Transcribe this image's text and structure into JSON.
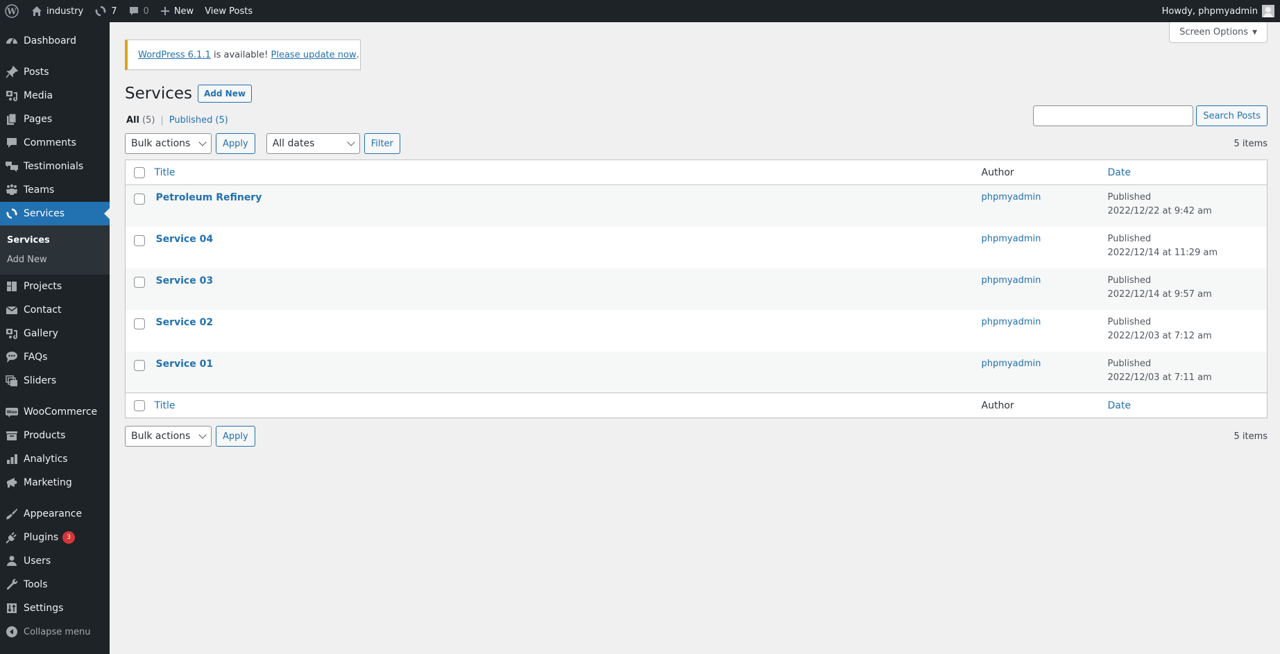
{
  "adminbar": {
    "site_name": "industry",
    "updates_count": "7",
    "comments_count": "0",
    "new_label": "New",
    "view_posts_label": "View Posts",
    "howdy": "Howdy, phpmyadmin"
  },
  "sidebar": {
    "items": [
      {
        "label": "Dashboard",
        "icon": "dashboard-icon"
      },
      {
        "label": "Posts",
        "icon": "pin-icon"
      },
      {
        "label": "Media",
        "icon": "media-icon"
      },
      {
        "label": "Pages",
        "icon": "pages-icon"
      },
      {
        "label": "Comments",
        "icon": "comment-icon"
      },
      {
        "label": "Testimonials",
        "icon": "testimonial-icon"
      },
      {
        "label": "Teams",
        "icon": "groups-icon"
      },
      {
        "label": "Services",
        "icon": "update-icon"
      },
      {
        "label": "Projects",
        "icon": "portfolio-icon"
      },
      {
        "label": "Contact",
        "icon": "email-icon"
      },
      {
        "label": "Gallery",
        "icon": "media-icon"
      },
      {
        "label": "FAQs",
        "icon": "chat-icon"
      },
      {
        "label": "Sliders",
        "icon": "slides-icon"
      },
      {
        "label": "WooCommerce",
        "icon": "woo-icon"
      },
      {
        "label": "Products",
        "icon": "archive-icon"
      },
      {
        "label": "Analytics",
        "icon": "chart-bar-icon"
      },
      {
        "label": "Marketing",
        "icon": "megaphone-icon"
      },
      {
        "label": "Appearance",
        "icon": "paintbrush-icon"
      },
      {
        "label": "Plugins",
        "icon": "plugin-icon",
        "badge": "3"
      },
      {
        "label": "Users",
        "icon": "user-icon"
      },
      {
        "label": "Tools",
        "icon": "wrench-icon"
      },
      {
        "label": "Settings",
        "icon": "settings-icon"
      }
    ],
    "submenu": [
      {
        "label": "Services"
      },
      {
        "label": "Add New"
      }
    ],
    "collapse_label": "Collapse menu"
  },
  "screen_options": "Screen Options",
  "notice": {
    "version_link": "WordPress 6.1.1",
    "middle_text": " is available! ",
    "update_link": "Please update now",
    "end": "."
  },
  "page": {
    "title": "Services",
    "add_new": "Add New"
  },
  "views": {
    "all_label": "All",
    "all_count": "(5)",
    "published_label": "Published",
    "published_count": "(5)",
    "separator": "|"
  },
  "search": {
    "value": "",
    "button": "Search Posts"
  },
  "tablenav_top": {
    "bulk_actions": "Bulk actions",
    "apply": "Apply",
    "dates": "All dates",
    "filter": "Filter",
    "items": "5 items"
  },
  "tablenav_bottom": {
    "bulk_actions": "Bulk actions",
    "apply": "Apply",
    "items": "5 items"
  },
  "table": {
    "columns": {
      "title": "Title",
      "author": "Author",
      "date": "Date"
    },
    "rows": [
      {
        "title": "Petroleum Refinery",
        "author": "phpmyadmin",
        "status": "Published",
        "date": "2022/12/22 at 9:42 am"
      },
      {
        "title": "Service 04",
        "author": "phpmyadmin",
        "status": "Published",
        "date": "2022/12/14 at 11:29 am"
      },
      {
        "title": "Service 03",
        "author": "phpmyadmin",
        "status": "Published",
        "date": "2022/12/14 at 9:57 am"
      },
      {
        "title": "Service 02",
        "author": "phpmyadmin",
        "status": "Published",
        "date": "2022/12/03 at 7:12 am"
      },
      {
        "title": "Service 01",
        "author": "phpmyadmin",
        "status": "Published",
        "date": "2022/12/03 at 7:11 am"
      }
    ]
  },
  "colors": {
    "accent": "#2271b1",
    "adminbar_bg": "#1d2327",
    "notice_warning": "#dba617",
    "badge": "#d63638"
  }
}
